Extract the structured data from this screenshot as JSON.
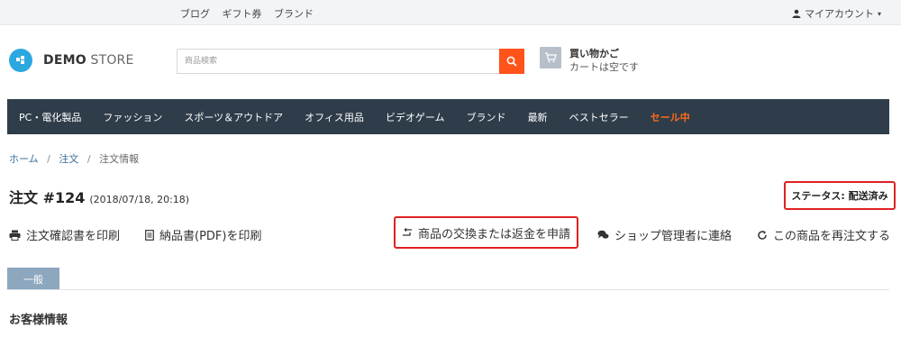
{
  "topbar": {
    "links": [
      "ブログ",
      "ギフト券",
      "ブランド"
    ],
    "account_label": "マイアカウント",
    "account_caret": "▾"
  },
  "header": {
    "logo_bold": "DEMO",
    "logo_light": "STORE",
    "search_placeholder": "商品検索",
    "cart_title": "買い物かご",
    "cart_subtitle": "カートは空です"
  },
  "nav": {
    "items": [
      "PC・電化製品",
      "ファッション",
      "スポーツ＆アウトドア",
      "オフィス用品",
      "ビデオゲーム",
      "ブランド",
      "最新",
      "ベストセラー",
      "セール中"
    ]
  },
  "breadcrumb": {
    "home": "ホーム",
    "orders": "注文",
    "current": "注文情報",
    "separator": "/"
  },
  "order": {
    "title": "注文 #124",
    "date": "(2018/07/18, 20:18)",
    "status": "ステータス: 配送済み"
  },
  "actions": {
    "print_confirmation": "注文確認書を印刷",
    "print_invoice": "納品書(PDF)を印刷",
    "request_refund": "商品の交換または返金を申請",
    "contact_admin": "ショップ管理者に連絡",
    "reorder": "この商品を再注文する"
  },
  "tabs": {
    "general": "一般"
  },
  "section": {
    "customer_info": "お客様情報"
  },
  "colors": {
    "nav_bg": "#2f3d4b",
    "sale": "#ff6a1a",
    "search_button": "#ff5319",
    "highlight_border": "#e02121",
    "tab_bg": "#8da7bf",
    "logo": "#2ba8e0"
  }
}
